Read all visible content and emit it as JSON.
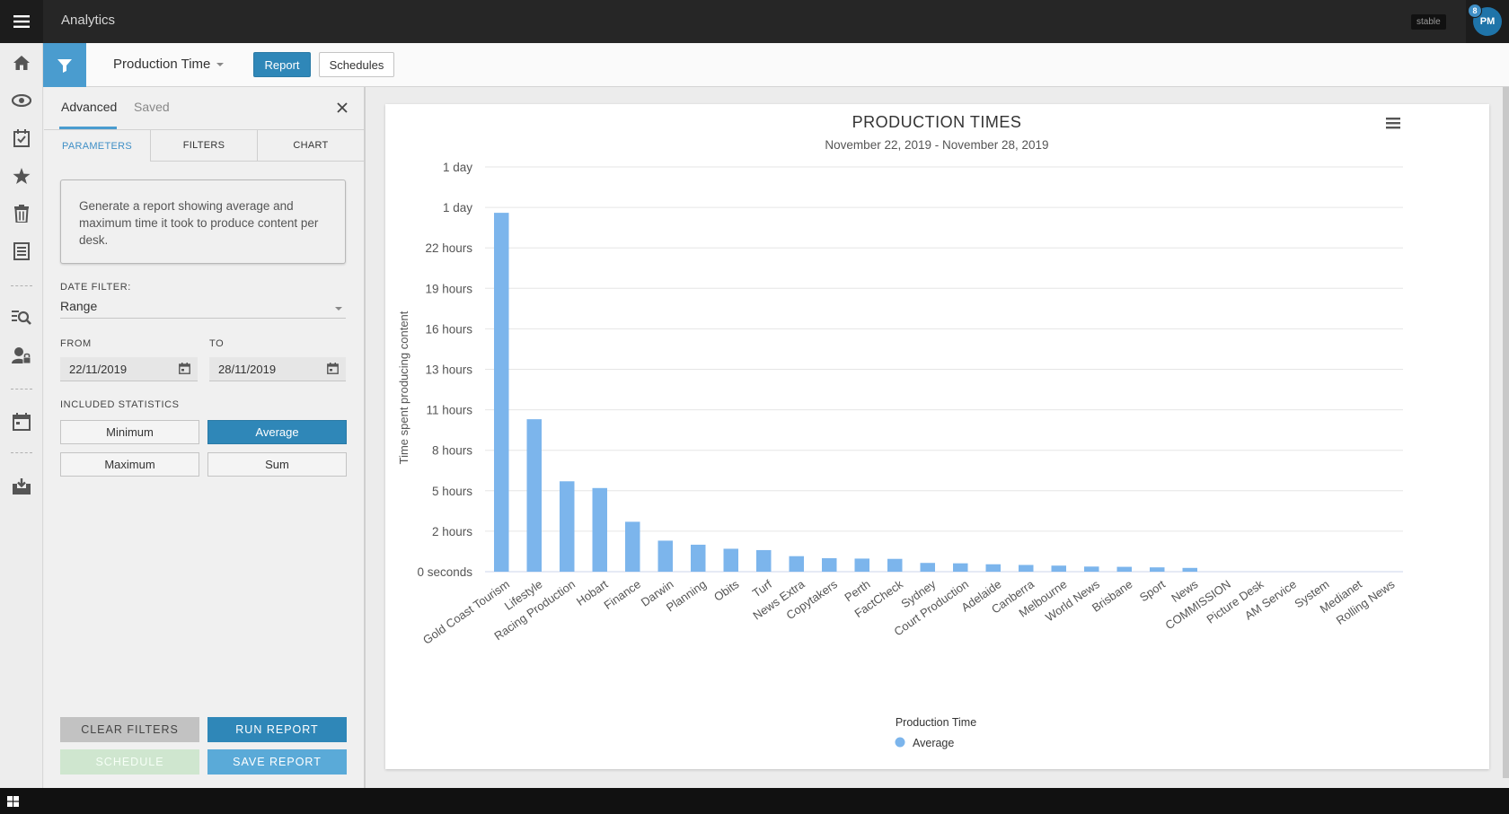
{
  "topbar": {
    "title": "Analytics",
    "env_badge": "stable",
    "avatar_initials": "PM",
    "notification_count": "8"
  },
  "subheader": {
    "report_name": "Production Time",
    "report_btn": "Report",
    "schedules_btn": "Schedules"
  },
  "panel": {
    "tab_advanced": "Advanced",
    "tab_saved": "Saved",
    "subtabs": [
      "PARAMETERS",
      "FILTERS",
      "CHART"
    ],
    "description": "Generate a report showing average and maximum time it took to produce content per desk.",
    "date_filter_label": "DATE FILTER:",
    "date_filter_value": "Range",
    "from_label": "FROM",
    "to_label": "TO",
    "from_value": "22/11/2019",
    "to_value": "28/11/2019",
    "stats_label": "INCLUDED STATISTICS",
    "stats": {
      "minimum": "Minimum",
      "average": "Average",
      "maximum": "Maximum",
      "sum": "Sum"
    },
    "actions": {
      "clear": "CLEAR FILTERS",
      "run": "RUN REPORT",
      "schedule": "SCHEDULE",
      "save": "SAVE REPORT"
    }
  },
  "colors": {
    "accent": "#2f87b8",
    "bar": "#7cb5ec",
    "topbar": "#262626"
  },
  "chart_data": {
    "type": "bar",
    "title": "PRODUCTION TIMES",
    "subtitle": "November 22, 2019 - November 28, 2019",
    "xlabel": "",
    "ylabel": "Time spent producing content",
    "y_unit": "hours",
    "ylim": [
      0,
      30
    ],
    "y_ticks": [
      0,
      3,
      6,
      9,
      12,
      15,
      18,
      21,
      24,
      27,
      30
    ],
    "y_tick_labels": [
      "0 seconds",
      "2 hours",
      "5 hours",
      "8 hours",
      "11 hours",
      "13 hours",
      "16 hours",
      "19 hours",
      "22 hours",
      "1 day",
      "1 day"
    ],
    "categories": [
      "Gold Coast Tourism",
      "Lifestyle",
      "Racing Production",
      "Hobart",
      "Finance",
      "Darwin",
      "Planning",
      "Obits",
      "Turf",
      "News Extra",
      "Copytakers",
      "Perth",
      "FactCheck",
      "Sydney",
      "Court Production",
      "Adelaide",
      "Canberra",
      "Melbourne",
      "World News",
      "Brisbane",
      "Sport",
      "News",
      "COMMISSION",
      "Picture Desk",
      "AM Service",
      "System",
      "Medianet",
      "Rolling News"
    ],
    "series": [
      {
        "name": "Average",
        "values": [
          26.6,
          11.3,
          6.7,
          6.2,
          3.7,
          2.3,
          2.0,
          1.7,
          1.6,
          1.15,
          1.0,
          0.97,
          0.95,
          0.65,
          0.62,
          0.55,
          0.5,
          0.45,
          0.38,
          0.36,
          0.32,
          0.28,
          0,
          0,
          0,
          0,
          0,
          0
        ]
      }
    ],
    "legend_title": "Production Time",
    "legend_position": "bottom-center",
    "grid": true
  }
}
